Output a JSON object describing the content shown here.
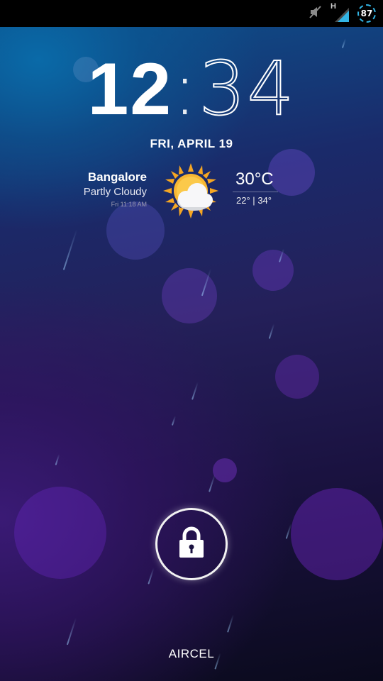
{
  "status_bar": {
    "icons": [
      "muted-speaker-icon",
      "hspa-signal-icon",
      "battery-icon"
    ],
    "network_type": "H",
    "battery_level": "87"
  },
  "lockscreen": {
    "clock": {
      "hours": "12",
      "separator": ":",
      "minutes": "34"
    },
    "date": "FRI, APRIL 19",
    "weather": {
      "city": "Bangalore",
      "condition": "Partly Cloudy",
      "updated": "Fri 11:18 AM",
      "temperature": "30°C",
      "low": "22°",
      "range_separator": "|",
      "high": "34°",
      "icon": "partly-cloudy-icon"
    },
    "unlock_icon": "lock-icon",
    "carrier": "AIRCEL"
  }
}
